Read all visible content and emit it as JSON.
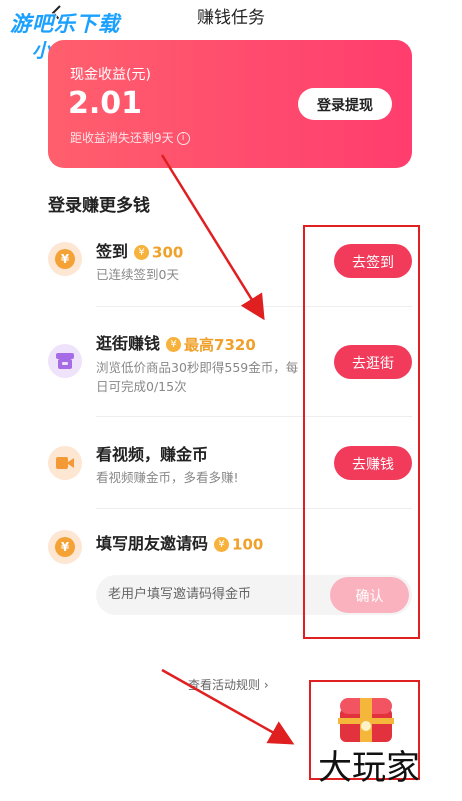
{
  "header": {
    "title": "赚钱任务",
    "back_icon": "chevron-left-icon"
  },
  "watermark": {
    "line1": "游吧乐下载",
    "line2": "小编亲测",
    "bottom": "大玩家"
  },
  "earnings": {
    "label": "现金收益(元)",
    "amount": "2.01",
    "note": "距收益消失还剩9天",
    "info_icon": "info-icon",
    "withdraw_button": "登录提现"
  },
  "section_title": "登录赚更多钱",
  "tasks": [
    {
      "title": "签到",
      "reward": "300",
      "subtitle": "已连续签到0天",
      "button": "去签到",
      "icon": "yen-coin-icon"
    },
    {
      "title": "逛街赚钱",
      "reward": "最高7320",
      "subtitle_line1": "浏览低价商品30秒即得559金币，每",
      "subtitle_line2": "日可完成0/15次",
      "button": "去逛街",
      "icon": "shop-icon"
    },
    {
      "title": "看视频，赚金币",
      "subtitle": "看视频赚金币，多看多赚!",
      "button": "去赚钱",
      "icon": "video-camera-icon"
    },
    {
      "title": "填写朋友邀请码",
      "reward": "100",
      "icon": "yen-coin-icon"
    }
  ],
  "invite": {
    "placeholder": "老用户填写邀请码得金币",
    "confirm_button": "确认"
  },
  "rules_link": "查看活动规则 ›",
  "colors": {
    "accent": "#f23a5b",
    "card_gradient_start": "#ff5f6d",
    "card_gradient_end": "#ff3d6e",
    "reward": "#f0a12b"
  }
}
